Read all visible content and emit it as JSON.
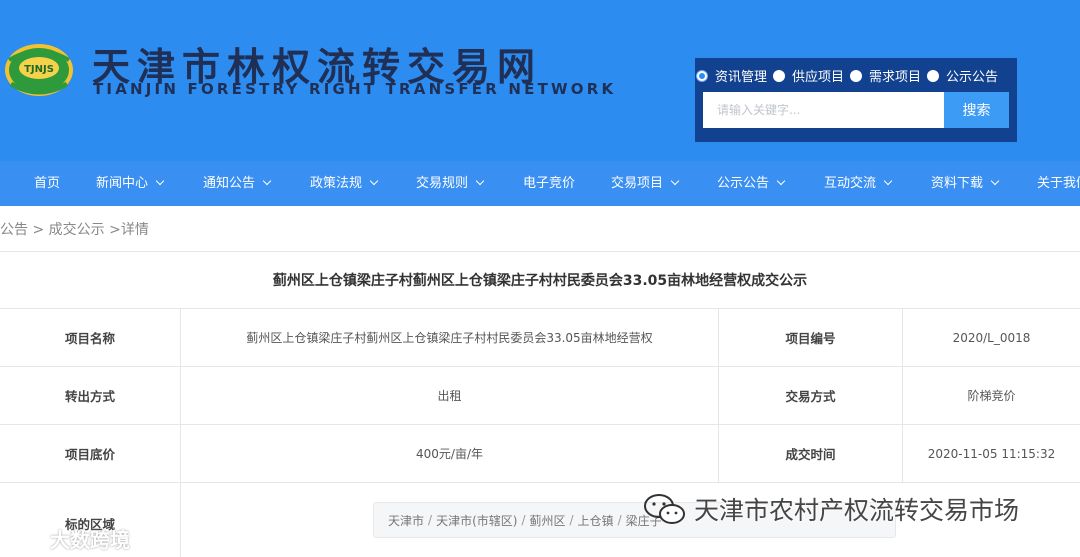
{
  "header": {
    "logo_text": "TJNJS",
    "title": "天津市林权流转交易网",
    "subtitle": "TIANJIN FORESTRY RIGHT TRANSFER NETWORK"
  },
  "search": {
    "options": [
      {
        "label": "资讯管理",
        "checked": true
      },
      {
        "label": "供应项目",
        "checked": false
      },
      {
        "label": "需求项目",
        "checked": false
      },
      {
        "label": "公示公告",
        "checked": false
      }
    ],
    "placeholder": "请输入关键字...",
    "button_label": "搜索"
  },
  "nav": {
    "items": [
      {
        "label": "首页",
        "has_dropdown": false
      },
      {
        "label": "新闻中心",
        "has_dropdown": true
      },
      {
        "label": "通知公告",
        "has_dropdown": true
      },
      {
        "label": "政策法规",
        "has_dropdown": true
      },
      {
        "label": "交易规则",
        "has_dropdown": true
      },
      {
        "label": "电子竞价",
        "has_dropdown": false
      },
      {
        "label": "交易项目",
        "has_dropdown": true
      },
      {
        "label": "公示公告",
        "has_dropdown": true
      },
      {
        "label": "互动交流",
        "has_dropdown": true
      },
      {
        "label": "资料下载",
        "has_dropdown": true
      },
      {
        "label": "关于我们",
        "has_dropdown": false
      }
    ]
  },
  "breadcrumb": {
    "items": [
      "公告",
      "成交公示",
      "详情"
    ]
  },
  "detail": {
    "title": "蓟州区上仓镇梁庄子村蓟州区上仓镇梁庄子村村民委员会33.05亩林地经营权成交公示",
    "rows": [
      {
        "label1": "项目名称",
        "value1": "蓟州区上仓镇梁庄子村蓟州区上仓镇梁庄子村村民委员会33.05亩林地经营权",
        "label2": "项目编号",
        "value2": "2020/L_0018"
      },
      {
        "label1": "转出方式",
        "value1": "出租",
        "label2": "交易方式",
        "value2": "阶梯竞价"
      },
      {
        "label1": "项目底价",
        "value1": "400元/亩/年",
        "label2": "成交时间",
        "value2": "2020-11-05 11:15:32"
      },
      {
        "label1": "标的区域"
      }
    ],
    "region_path": [
      "天津市",
      "天津市(市辖区)",
      "蓟州区",
      "上仓镇",
      "梁庄子"
    ]
  },
  "watermarks": {
    "right": "天津市农村产权流转交易市场",
    "left": "大数跨境"
  }
}
